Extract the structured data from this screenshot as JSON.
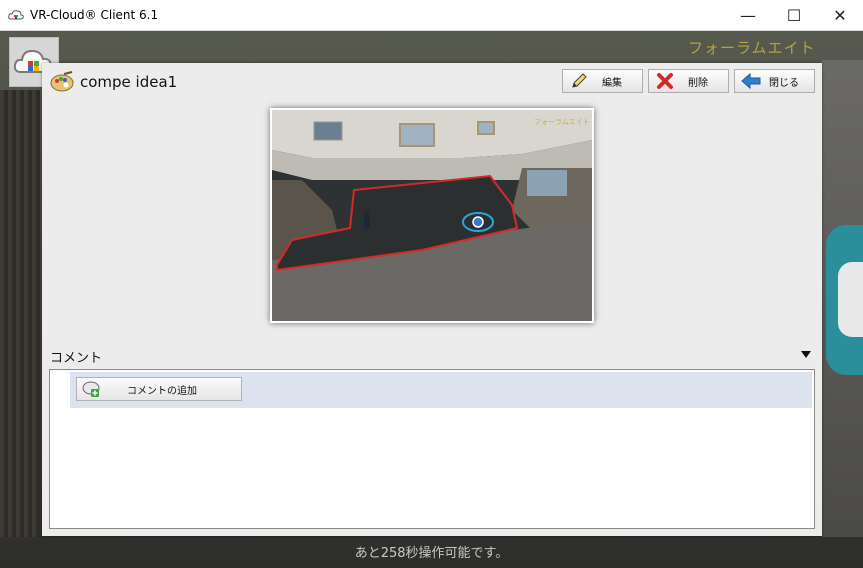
{
  "window": {
    "title": "VR-Cloud® Client 6.1",
    "minimize_glyph": "—",
    "maximize_glyph": "☐",
    "close_glyph": "✕"
  },
  "scene": {
    "watermark": "フォーラムエイト",
    "cloud_button_icon": "cloud-icon"
  },
  "panel": {
    "title": "compe idea1",
    "title_icon": "palette-icon",
    "toolbar": {
      "edit_label": "編集",
      "edit_icon": "pencil-icon",
      "delete_label": "削除",
      "delete_icon": "red-x-icon",
      "close_label": "閉じる",
      "close_icon": "blue-left-arrow-icon"
    },
    "thumbnail": {
      "watermark": "フォーラムエイト"
    },
    "comments": {
      "header": "コメント",
      "add_label": "コメントの追加",
      "add_icon": "add-comment-icon"
    }
  },
  "status": {
    "timer_text": "あと258秒操作可能です。"
  },
  "colors": {
    "accent_red": "#d42a2a",
    "accent_blue": "#2f7fd0",
    "comment_row_bg": "#dde3ee",
    "watermark_yellow": "#c4b23a"
  }
}
